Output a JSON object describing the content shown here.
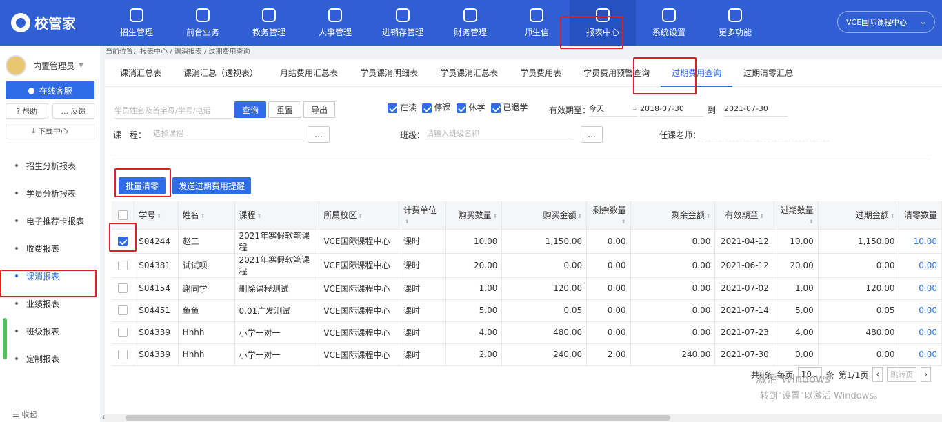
{
  "logo": {
    "text": "校管家"
  },
  "nav": [
    {
      "label": "招生管理",
      "icon": "add-user-icon"
    },
    {
      "label": "前台业务",
      "icon": "monitor-icon"
    },
    {
      "label": "教务管理",
      "icon": "book-icon"
    },
    {
      "label": "人事管理",
      "icon": "person-icon"
    },
    {
      "label": "进销存管理",
      "icon": "export-icon"
    },
    {
      "label": "财务管理",
      "icon": "money-icon"
    },
    {
      "label": "师生信",
      "icon": "chat-icon"
    },
    {
      "label": "报表中心",
      "icon": "report-icon"
    },
    {
      "label": "系统设置",
      "icon": "gear-icon"
    },
    {
      "label": "更多功能",
      "icon": "more-icon"
    }
  ],
  "school_selector": {
    "label": "VCE国际课程中心"
  },
  "sidebar": {
    "user": "内置管理员",
    "service_btn": "在线客服",
    "help": "帮助",
    "feedback": "反馈",
    "download": "下载中心",
    "items": [
      "招生分析报表",
      "学员分析报表",
      "电子推荐卡报表",
      "收费报表",
      "课消报表",
      "业绩报表",
      "班级报表",
      "定制报表"
    ],
    "collapse": "收起"
  },
  "breadcrumb": "当前位置：报表中心 / 课消报表 / 过期费用查询",
  "tabs": [
    "课消汇总表",
    "课消汇总（透视表）",
    "月结费用汇总表",
    "学员课消明细表",
    "学员课消汇总表",
    "学员费用表",
    "学员费用预警查询",
    "过期费用查询",
    "过期清零汇总"
  ],
  "filters": {
    "search_placeholder": "学员姓名及首字母/学号/电话",
    "query": "查询",
    "reset": "重置",
    "export": "导出",
    "status": [
      "在读",
      "停课",
      "休学",
      "已退学"
    ],
    "valid_label": "有效期至：",
    "valid_option": "今天",
    "date_from": "2018-07-30",
    "date_to_label": "到",
    "date_to": "2021-07-30",
    "course_label": "课　程：",
    "course_placeholder": "选择课程",
    "class_label": "班级：",
    "class_placeholder": "请输入班级名称",
    "teacher_label": "任课老师：",
    "dots": "..."
  },
  "actions": {
    "clear": "批量清零",
    "remind": "发送过期费用提醒"
  },
  "table": {
    "headers": [
      "学号",
      "姓名",
      "课程",
      "所属校区",
      "计费单位",
      "购买数量",
      "购买金额",
      "剩余数量",
      "剩余金额",
      "有效期至",
      "过期数量",
      "过期金额",
      "清零数量"
    ],
    "rows": [
      [
        "S04244",
        "赵三",
        "2021年寒假软笔课程",
        "VCE国际课程中心",
        "课时",
        "10.00",
        "1,150.00",
        "0.00",
        "0.00",
        "2021-04-12",
        "10.00",
        "1,150.00",
        "10.00"
      ],
      [
        "S04381",
        "试试呗",
        "2021年寒假软笔课程",
        "VCE国际课程中心",
        "课时",
        "20.00",
        "0.00",
        "0.00",
        "0.00",
        "2021-06-12",
        "20.00",
        "0.00",
        "0.00"
      ],
      [
        "S04154",
        "谢同学",
        "删除课程测试",
        "VCE国际课程中心",
        "课时",
        "1.00",
        "120.00",
        "0.00",
        "0.00",
        "2021-07-02",
        "1.00",
        "120.00",
        "0.00"
      ],
      [
        "S04451",
        "鱼鱼",
        "0.01广发测试",
        "VCE国际课程中心",
        "课时",
        "5.00",
        "0.05",
        "0.00",
        "0.00",
        "2021-07-14",
        "5.00",
        "0.05",
        "0.00"
      ],
      [
        "S04339",
        "Hhhh",
        "小学一对一",
        "VCE国际课程中心",
        "课时",
        "4.00",
        "480.00",
        "0.00",
        "0.00",
        "2021-07-23",
        "4.00",
        "480.00",
        "0.00"
      ],
      [
        "S04339",
        "Hhhh",
        "小学一对一",
        "VCE国际课程中心",
        "课时",
        "2.00",
        "240.00",
        "2.00",
        "240.00",
        "2021-07-30",
        "0.00",
        "0.00",
        "0.00"
      ]
    ],
    "checked": [
      true,
      false,
      false,
      false,
      false,
      false
    ]
  },
  "pager": {
    "total": "共6条",
    "per_page_label": "每页",
    "per_page": "10",
    "unit": "条",
    "page": "第1/1页",
    "jump": "跳转页"
  },
  "watermark": {
    "line1": "激活 Windows",
    "line2": "转到\"设置\"以激活 Windows。"
  }
}
